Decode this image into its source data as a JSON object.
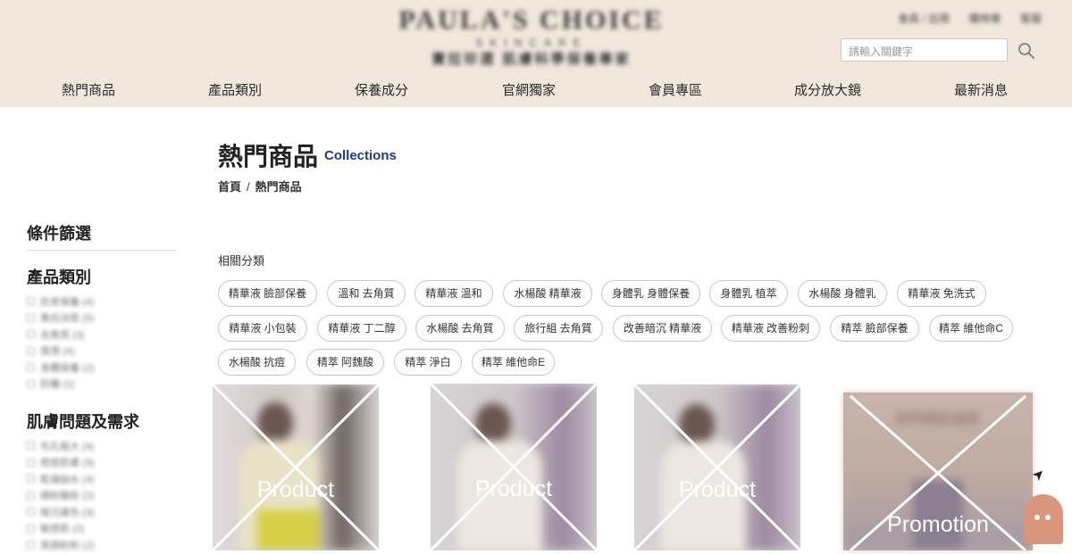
{
  "header": {
    "brand": "PAULA'S CHOICE",
    "brand_sub": "SKINCARE",
    "slogan": "寶拉珍選 肌膚科學保養專家",
    "top_links": [
      "會員 / 註冊",
      "購物車",
      "客服"
    ],
    "search_placeholder": "請輸入關鍵字"
  },
  "nav": [
    "熱門商品",
    "產品類別",
    "保養成分",
    "官網獨家",
    "會員專區",
    "成分放大鏡",
    "最新消息"
  ],
  "page": {
    "title": "熱門商品",
    "subtitle": "Collections",
    "breadcrumb": [
      "首頁",
      "熱門商品"
    ],
    "breadcrumb_sep": "/"
  },
  "sidebar": {
    "filter_title": "條件篩選",
    "category_title": "產品類別",
    "category_items": [
      "抗老保養 (4)",
      "美白淡斑 (5)",
      "去角質 (3)",
      "保濕 (4)",
      "身體保養 (2)",
      "防曬 (1)"
    ],
    "concern_title": "肌膚問題及需求",
    "concern_items": [
      "毛孔粗大 (4)",
      "痘痘肌膚 (3)",
      "乾燥缺水 (4)",
      "細紋皺紋 (2)",
      "暗沉膚色 (3)",
      "敏感肌 (2)",
      "黑頭粉刺 (2)"
    ]
  },
  "related": {
    "title": "相關分類",
    "tags": [
      "精華液 臉部保養",
      "溫和 去角質",
      "精華液 溫和",
      "水楊酸 精華液",
      "身體乳 身體保養",
      "身體乳 植萃",
      "水楊酸 身體乳",
      "精華液 免洗式",
      "精華液 小包裝",
      "精華液 丁二醇",
      "水楊酸 去角質",
      "旅行組 去角質",
      "改善暗沉 精華液",
      "精華液 改善粉刺",
      "精萃 臉部保養",
      "精萃 維他命C",
      "水楊酸 抗痘",
      "精萃 阿魏酸",
      "精萃 淨白",
      "精萃 維他命E"
    ]
  },
  "products": [
    {
      "label": "Product"
    },
    {
      "label": "Product"
    },
    {
      "label": "Product"
    },
    {
      "label": "Promotion",
      "promo_text": "限時獨家優惠"
    }
  ]
}
